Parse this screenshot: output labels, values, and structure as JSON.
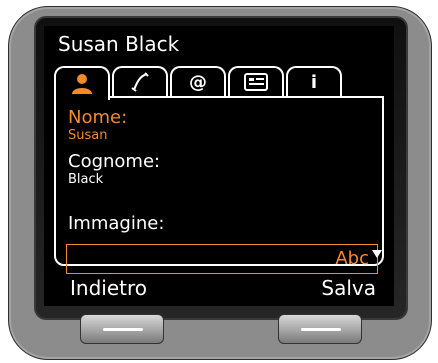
{
  "header": {
    "title": "Susan Black"
  },
  "tabs": [
    {
      "id": "person",
      "icon": "person-icon",
      "active": true
    },
    {
      "id": "phone",
      "icon": "phone-handset-icon"
    },
    {
      "id": "email",
      "icon": "at-sign-icon",
      "label": "@"
    },
    {
      "id": "card",
      "icon": "contact-card-icon"
    },
    {
      "id": "info",
      "icon": "info-icon",
      "label": "i"
    }
  ],
  "fields": {
    "nome": {
      "label": "Nome:",
      "value": "Susan"
    },
    "cognome": {
      "label": "Cognome:",
      "value": "Black"
    },
    "immagine": {
      "label": "Immagine:",
      "input_mode": "Abc"
    }
  },
  "softkeys": {
    "left": "Indietro",
    "right": "Salva"
  },
  "colors": {
    "accent": "#f28a2e",
    "screen_bg": "#000000",
    "text": "#ffffff"
  }
}
